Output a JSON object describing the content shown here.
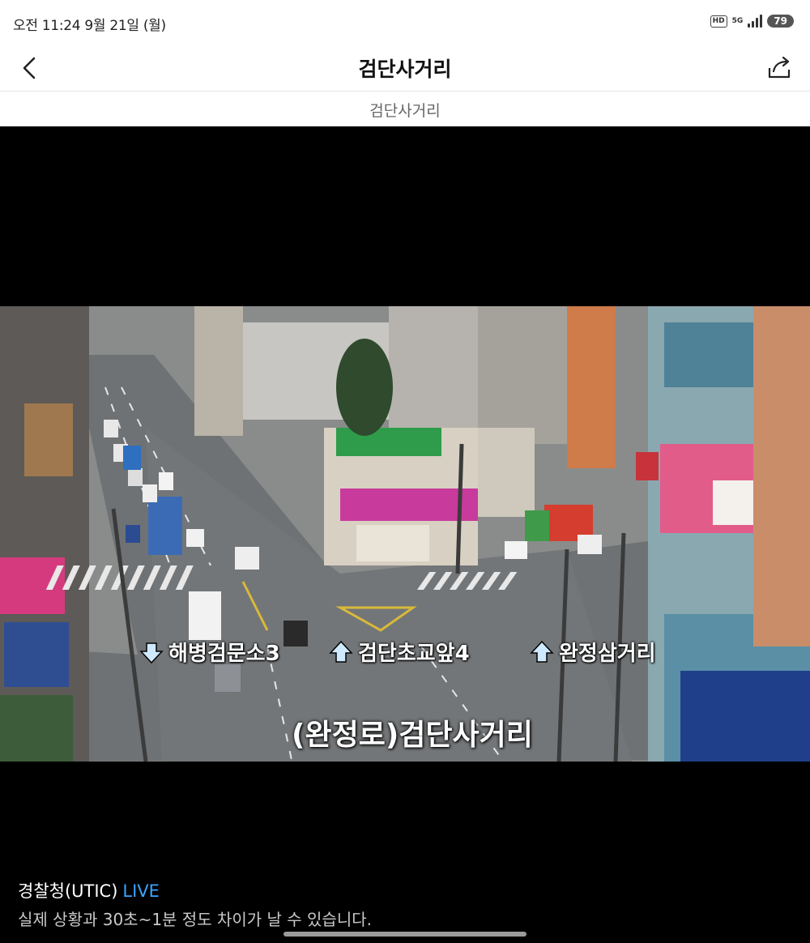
{
  "status_bar": {
    "time_date": "오전 11:24  9월 21일 (월)",
    "hd_label": "HD",
    "network_label": "5G",
    "battery_level": "79"
  },
  "header": {
    "title": "검단사거리",
    "back_icon": "chevron-left-icon",
    "share_icon": "share-icon"
  },
  "subheader": {
    "location_name": "검단사거리"
  },
  "camera_overlay": {
    "directions": [
      {
        "arrow": "down",
        "label": "해병검문소3"
      },
      {
        "arrow": "up",
        "label": "검단초교앞4"
      },
      {
        "arrow": "up",
        "label": "완정삼거리"
      }
    ],
    "camera_name": "(완정로)검단사거리"
  },
  "footer": {
    "source": "경찰청(UTIC)",
    "live_label": "LIVE",
    "disclaimer": "실제 상황과 30초~1분 정도 차이가 날 수 있습니다.",
    "live_color": "#3aa3ff"
  }
}
